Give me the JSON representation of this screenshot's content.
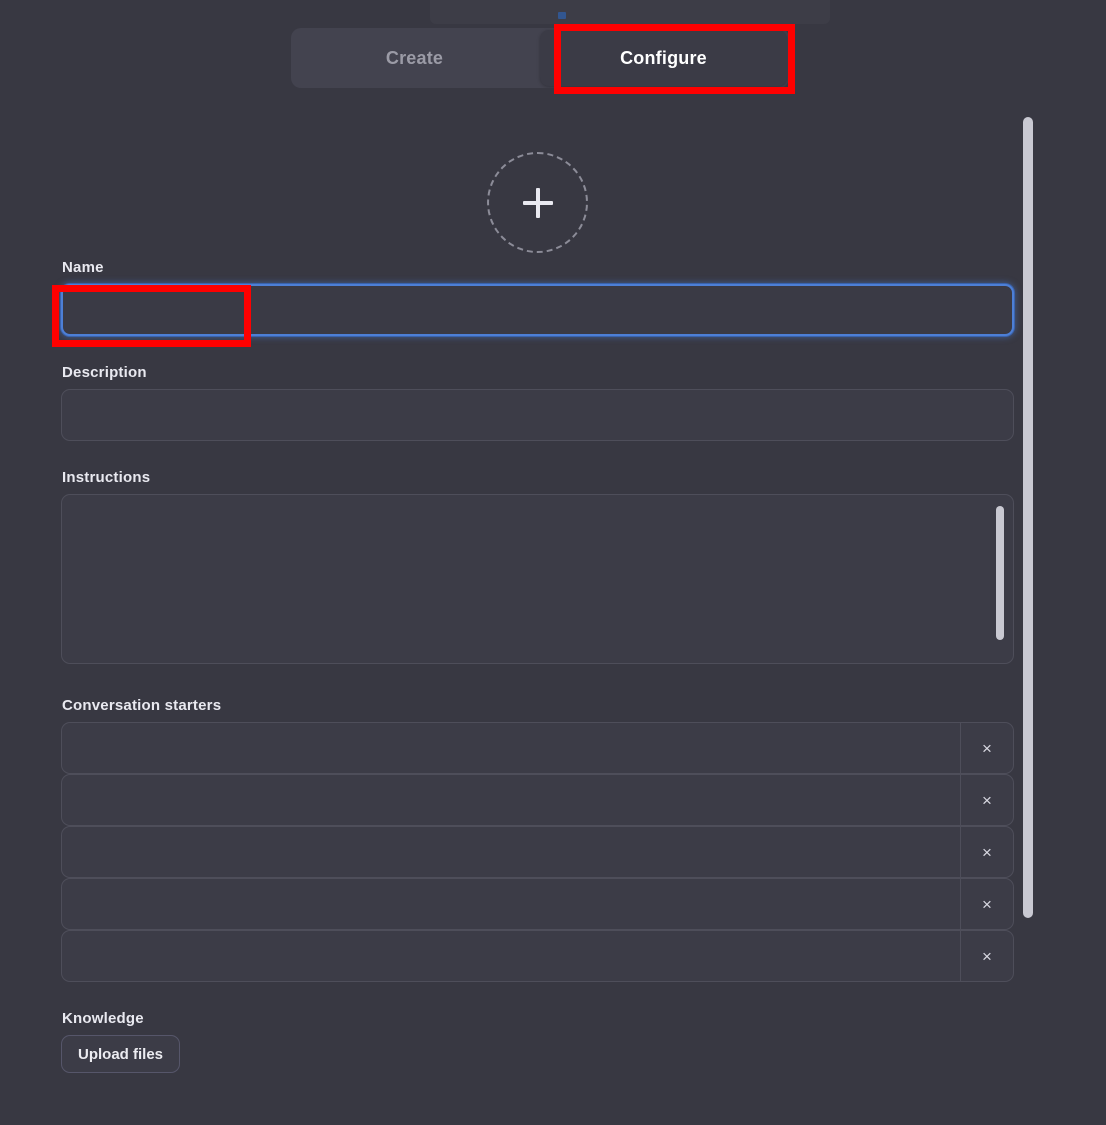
{
  "window": {
    "background_color": "#383842",
    "accent_focus_color": "#4d7fd6",
    "annotation_color": "#fe0000"
  },
  "tabs": [
    {
      "id": "create",
      "label": "Create",
      "active": false
    },
    {
      "id": "configure",
      "label": "Configure",
      "active": true
    }
  ],
  "avatar": {
    "icon": "plus-icon",
    "label": "+"
  },
  "form": {
    "name": {
      "label": "Name",
      "value": "",
      "placeholder": "",
      "focused": true
    },
    "description": {
      "label": "Description",
      "value": "",
      "placeholder": ""
    },
    "instructions": {
      "label": "Instructions",
      "value": "",
      "placeholder": ""
    },
    "conversation_starters": {
      "label": "Conversation starters",
      "remove_icon": "close-icon",
      "remove_label": "×",
      "rows": [
        {
          "value": "",
          "placeholder": ""
        },
        {
          "value": "",
          "placeholder": ""
        },
        {
          "value": "",
          "placeholder": ""
        },
        {
          "value": "",
          "placeholder": ""
        },
        {
          "value": "",
          "placeholder": ""
        }
      ]
    },
    "knowledge": {
      "label": "Knowledge",
      "upload_button_label": "Upload files"
    }
  },
  "scrollbars": {
    "page": {
      "name": "page-scrollbar"
    },
    "instructions": {
      "name": "instructions-scrollbar"
    }
  }
}
